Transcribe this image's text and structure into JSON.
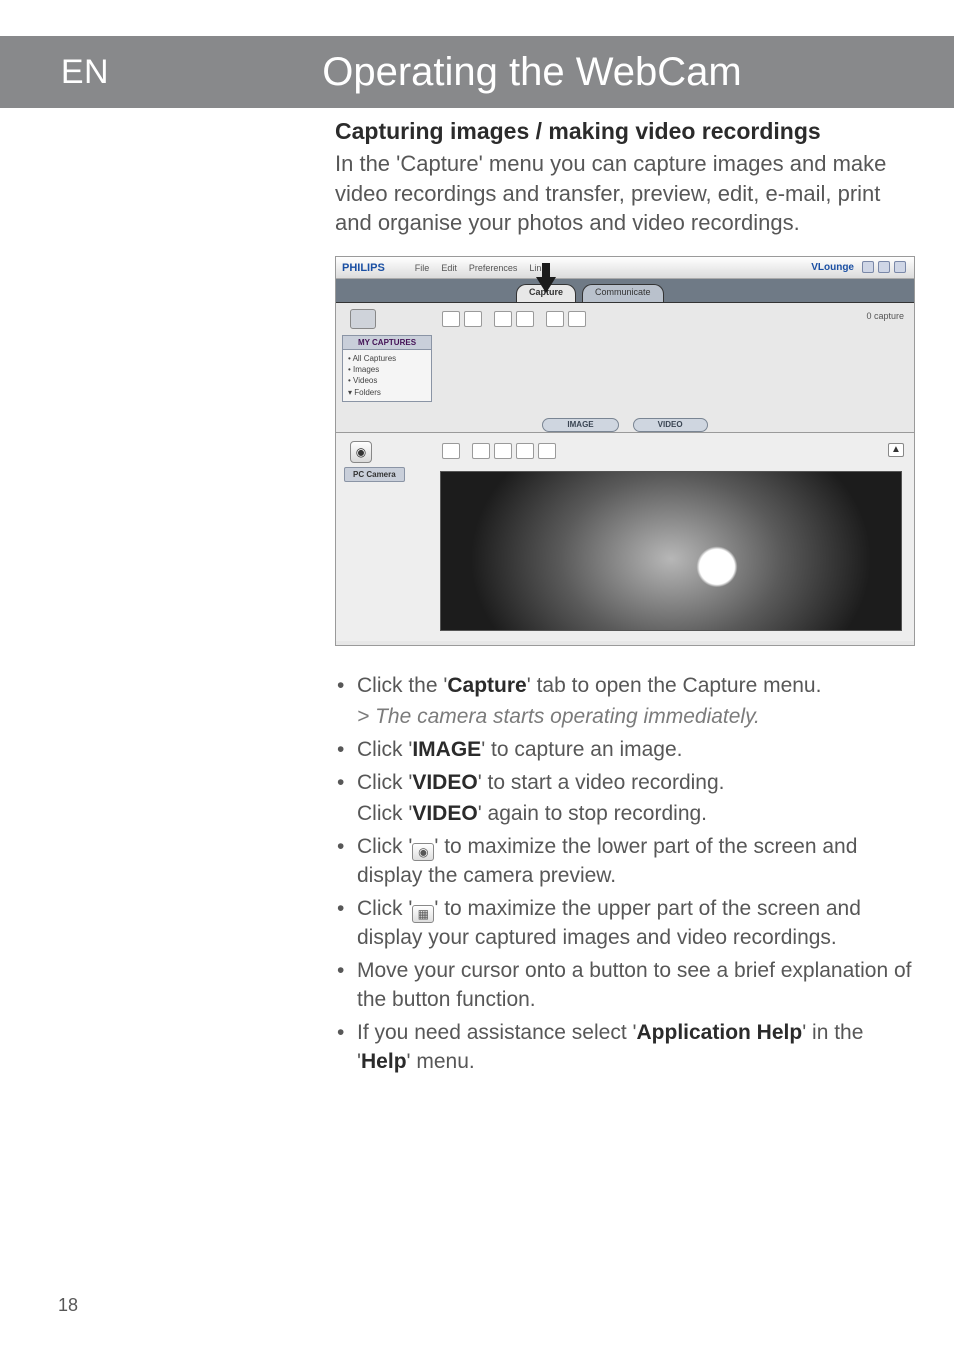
{
  "lang_tab": "EN",
  "title": "Operating the WebCam",
  "heading": "Capturing images / making video recordings",
  "intro": "In the 'Capture' menu you can capture images and make video recordings and transfer, preview, edit, e-mail, print and organise your photos and video recordings.",
  "page_number": "18",
  "screenshot": {
    "brand": "PHILIPS",
    "menu": {
      "file": "File",
      "edit": "Edit",
      "preferences": "Preferences",
      "links": "Links"
    },
    "app_name": "VLounge",
    "tabs": {
      "capture": "Capture",
      "communicate": "Communicate"
    },
    "side_header": "MY CAPTURES",
    "side_items": {
      "all": "• All Captures",
      "images": "• Images",
      "videos": "• Videos",
      "folders": "▾ Folders"
    },
    "capture_count": "0 capture",
    "mid_image": "IMAGE",
    "mid_video": "VIDEO",
    "pc_camera": "PC Camera",
    "cam_glyph": "◉",
    "collapse_glyph": "▲"
  },
  "bullets": {
    "b1_a": "Click the '",
    "b1_b": "Capture",
    "b1_c": "' tab to open the Capture menu.",
    "b1_sub": "> The camera starts operating immediately.",
    "b2_a": "Click '",
    "b2_b": "IMAGE",
    "b2_c": "' to capture an image.",
    "b3_a": "Click '",
    "b3_b": "VIDEO",
    "b3_c": "' to start a video recording.",
    "b3_sub_a": "Click '",
    "b3_sub_b": "VIDEO",
    "b3_sub_c": "' again to stop recording.",
    "b4_a": "Click '",
    "b4_b": "' to maximize the lower part of the screen and display the camera preview.",
    "b5_a": "Click '",
    "b5_b": "' to maximize the upper part of the screen and display your captured images and video recordings.",
    "b6": "Move your cursor onto a button to see a brief explanation of the button function.",
    "b7_a": "If you need assistance select '",
    "b7_b": "Application Help",
    "b7_c": "' in the '",
    "b7_d": "Help",
    "b7_e": "' menu."
  },
  "icons": {
    "camera_glyph": "◉",
    "thumb_glyph": "▦"
  }
}
